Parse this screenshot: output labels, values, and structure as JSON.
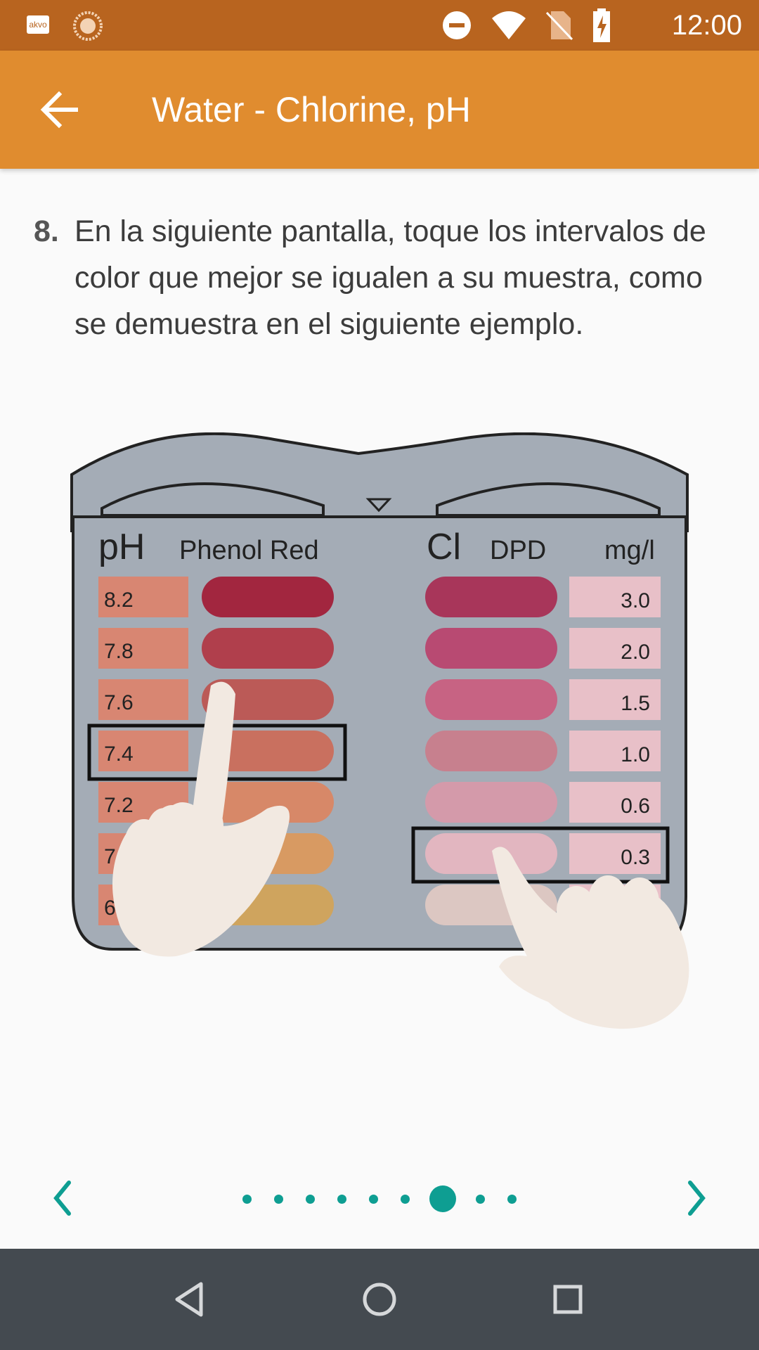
{
  "status_bar": {
    "time": "12:00",
    "app_icon_label": "akvo",
    "icons": [
      "akvo-icon",
      "sun-icon",
      "do-not-disturb-icon",
      "wifi-icon",
      "no-sim-icon",
      "battery-charging-icon"
    ]
  },
  "app_bar": {
    "title": "Water - Chlorine, pH",
    "back_icon": "arrow-left-icon"
  },
  "instruction": {
    "number": "8.",
    "text": "En la siguiente pantalla, toque los intervalos de color que mejor se igualen a su muestra, como se demuestra en el siguiente ejemplo."
  },
  "illustration": {
    "ph_heading": "pH",
    "phenol_heading": "Phenol Red",
    "cl_heading": "Cl",
    "dpd_heading": "DPD",
    "unit_heading": "mg/l",
    "ph_values": [
      "8.2",
      "7.8",
      "7.6",
      "7.4",
      "7.2",
      "7.",
      "6."
    ],
    "cl_values": [
      "3.0",
      "2.0",
      "1.5",
      "1.0",
      "0.6",
      "0.3",
      ""
    ],
    "ph_colors": [
      "#A2263F",
      "#B03F4C",
      "#BB5A57",
      "#C9705F",
      "#D78868",
      "#D89A62",
      "#CFA45E"
    ],
    "cl_colors": [
      "#A8365A",
      "#B84A72",
      "#C76383",
      "#C7808E",
      "#D49AAA",
      "#E2B6C0",
      "#DCC7C2"
    ],
    "selected_ph": "7.4",
    "selected_cl": "0.3"
  },
  "pager": {
    "prev_icon": "chevron-left-icon",
    "next_icon": "chevron-right-icon",
    "page_count": 9,
    "current_page": 7,
    "accent": "#0E9E92"
  },
  "nav_bar": {
    "icons": [
      "back-triangle-icon",
      "home-circle-icon",
      "recents-square-icon"
    ]
  }
}
